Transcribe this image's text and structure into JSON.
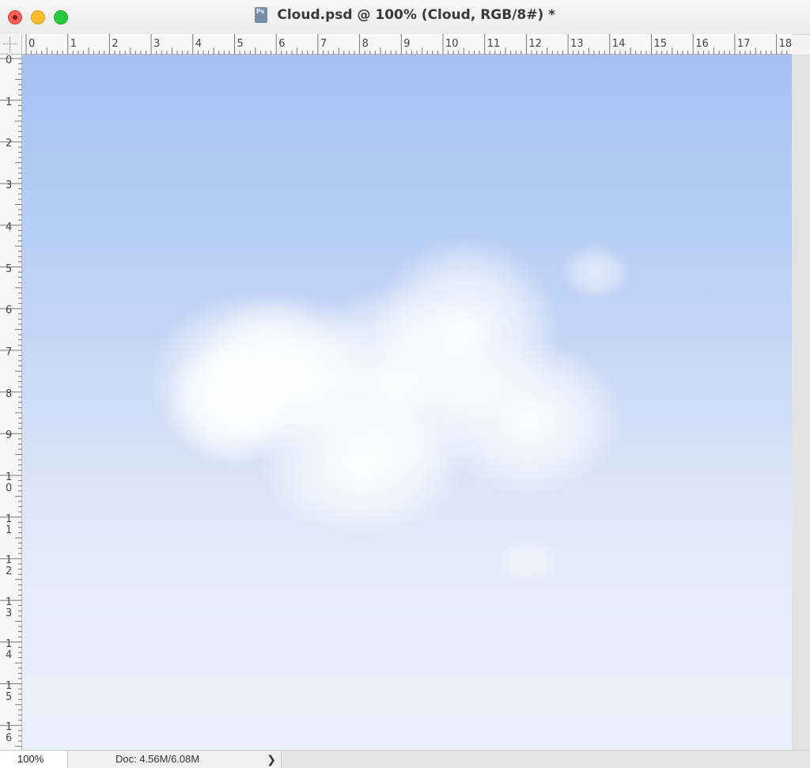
{
  "window": {
    "title": "Cloud.psd @ 100% (Cloud, RGB/8#) *",
    "file_icon": "photoshop-document-icon",
    "file_icon_text": "Ps"
  },
  "traffic_lights": {
    "close_color": "#fe5f57",
    "minimize_color": "#febc2e",
    "maximize_color": "#28c840"
  },
  "ruler": {
    "horizontal_labels": [
      "0",
      "1",
      "2",
      "3",
      "4",
      "5",
      "6",
      "7",
      "8",
      "9",
      "10",
      "11",
      "12",
      "13",
      "14",
      "15",
      "16",
      "17",
      "18"
    ],
    "vertical_labels": [
      "0",
      "1",
      "2",
      "3",
      "4",
      "5",
      "6",
      "7",
      "8",
      "9",
      "10",
      "11",
      "12",
      "13",
      "14",
      "15",
      "16"
    ]
  },
  "canvas": {
    "content": "cloud-image",
    "sky_top_color": "#a7c0f1",
    "sky_bottom_color": "#eaf0f9"
  },
  "status": {
    "zoom": "100%",
    "doc_info": "Doc: 4.56M/6.08M",
    "menu_arrow": "❯"
  }
}
